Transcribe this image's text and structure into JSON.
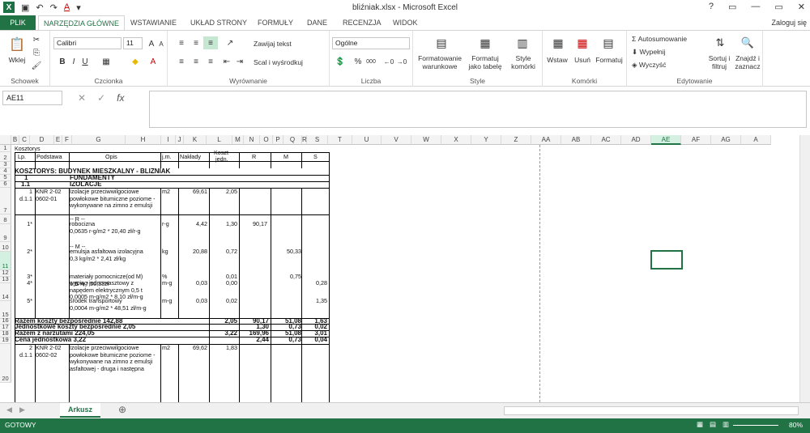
{
  "app": {
    "title": "bliźniak.xlsx - Microsoft Excel",
    "login": "Zaloguj się",
    "window_controls": [
      "?",
      "▭",
      "—",
      "▭",
      "✕"
    ]
  },
  "tabs": [
    "PLIK",
    "NARZĘDZIA GŁÓWNE",
    "WSTAWIANIE",
    "UKŁAD STRONY",
    "FORMUŁY",
    "DANE",
    "RECENZJA",
    "WIDOK"
  ],
  "ribbon": {
    "clipboard": {
      "paste": "Wklej",
      "label": "Schowek"
    },
    "font": {
      "name": "Calibri",
      "size": "11",
      "label": "Czcionka",
      "bold": "B",
      "italic": "I",
      "underline": "U",
      "grow": "A",
      "shrink": "A",
      "color_letter": "A"
    },
    "alignment": {
      "wrap": "Zawijaj tekst",
      "merge": "Scal i wyśrodkuj",
      "label": "Wyrównanie"
    },
    "number": {
      "format": "Ogólne",
      "label": "Liczba",
      "percent": "%",
      "thousands": "000"
    },
    "styles": {
      "cond_format": [
        "Formatowanie",
        "warunkowe"
      ],
      "format_table": [
        "Formatuj",
        "jako tabelę"
      ],
      "cell_style": [
        "Style",
        "komórki"
      ],
      "label": "Style"
    },
    "cells": {
      "insert": "Wstaw",
      "delete": "Usuń",
      "format": "Formatuj",
      "label": "Komórki"
    },
    "editing": {
      "autosum": "Autosumowanie",
      "fill": "Wypełnij",
      "clear": "Wyczyść",
      "sort": [
        "Sortuj i",
        "filtruj"
      ],
      "find": [
        "Znajdź i",
        "zaznacz"
      ],
      "label": "Edytowanie"
    }
  },
  "formula_bar": {
    "name_box": "AE11",
    "fx": "fx",
    "cancel": "✕",
    "enter": "✓",
    "value": ""
  },
  "columns": [
    "B",
    "C",
    "D",
    "E",
    "F",
    "G",
    "H",
    "I",
    "J",
    "K",
    "L",
    "M",
    "N",
    "O",
    "P",
    "Q",
    "R",
    "S",
    "T",
    "U",
    "V",
    "W",
    "X",
    "Y",
    "Z",
    "AA",
    "AB",
    "AC",
    "AD",
    "AE",
    "AF",
    "AG",
    "A"
  ],
  "rows": [
    "1",
    "2",
    "3",
    "4",
    "5",
    "6",
    "7",
    "8",
    "9",
    "10",
    "11",
    "12",
    "13",
    "14",
    "15",
    "16",
    "17",
    "18",
    "19",
    "20"
  ],
  "sheet": {
    "r1": "Kosztorys",
    "hdr": {
      "lp": "Lp.",
      "podstawa": "Podstawa",
      "opis": "Opis",
      "jm": "j.m.",
      "naklady": "Nakłady",
      "koszt": [
        "Koszt",
        "jedn."
      ],
      "R": "R",
      "M": "M",
      "S": "S"
    },
    "title": "KOSZTORYS: BUDYNEK MIESZKALNY - BLIŹNIAK",
    "sec1_no": "1",
    "sec1": "FUNDAMENTY",
    "sec11_no": "1.1",
    "sec11": "IZOLACJE",
    "i1": {
      "lp": [
        "1",
        "d.1.1"
      ],
      "podstawa": [
        "KNR 2-02",
        "0602-01"
      ],
      "opis": [
        "Izolacje przeciwwilgociowe",
        "powłokowe bitumiczne poziome -",
        "wykonywane na zimno z emulsji"
      ],
      "jm": "m2",
      "naklady": "69,61",
      "koszt": "2,05"
    },
    "rR_head": "-- R --",
    "r9": {
      "lp": "1*",
      "opis": [
        "robocizna",
        "0,0635 r-g/m2 * 20,40 zł/r-g"
      ],
      "jm": "r-g",
      "naklady": "4,42",
      "koszt": "1,30",
      "R": "90,17"
    },
    "rM_head": "-- M --",
    "r11": {
      "lp": "2*",
      "opis": [
        "emulsja asfaltowa izolacyjna",
        "0,3 kg/m2 * 2,41 zł/kg"
      ],
      "jm": "kg",
      "naklady": "20,88",
      "koszt": "0,72",
      "M": "50,33"
    },
    "r12": {
      "lp": "3*",
      "opis": [
        "materiały pomocnicze(od M)",
        "1,5 % * 50,33zł"
      ],
      "jm": "%",
      "koszt": "0,01",
      "M": "0,75"
    },
    "rS_head": "-- S --",
    "r14": {
      "lp": "4*",
      "opis": [
        "wyciąg jednomasztowy z",
        "napędem elektrycznym 0,5 t",
        "0,0005 m-g/m2 * 8,10 zł/m-g"
      ],
      "jm": "m-g",
      "naklady": "0,03",
      "koszt": "0,00",
      "S": "0,28"
    },
    "r15": {
      "lp": "5*",
      "opis": [
        "środek transportowy",
        "0,0004 m-g/m2 * 48,51 zł/m-g"
      ],
      "jm": "m-g",
      "naklady": "0,03",
      "koszt": "0,02",
      "S": "1,35"
    },
    "t16": {
      "label": "Razem koszty bezpośrednie 142,88",
      "koszt": "2,05",
      "R": "90,17",
      "M": "51,08",
      "S": "1,63"
    },
    "t17": {
      "label": "Jednostkowe koszty bezpośrednie 2,05",
      "R": "1,30",
      "M": "0,73",
      "S": "0,02"
    },
    "t18": {
      "label": "Razem z narzutami 224,05",
      "koszt": "3,22",
      "R": "169,96",
      "M": "51,08",
      "S": "3,01"
    },
    "t19": {
      "label": "Cena jednostkowa 3,22",
      "R": "2,44",
      "M": "0,73",
      "S": "0,04"
    },
    "i2": {
      "lp": [
        "2",
        "d.1.1"
      ],
      "podstawa": [
        "KNR 2-02",
        "0602-02"
      ],
      "opis": [
        "Izolacje przeciwwilgociowe",
        "powłokowe bitumiczne poziome -",
        "wykonywane na zimno z emulsji",
        "asfaltowej - druga i następna"
      ],
      "jm": "m2",
      "naklady": "69,62",
      "koszt": "1,83"
    }
  },
  "sheet_tab": "Arkusz",
  "status": {
    "ready": "GOTOWY",
    "zoom": "80%"
  }
}
